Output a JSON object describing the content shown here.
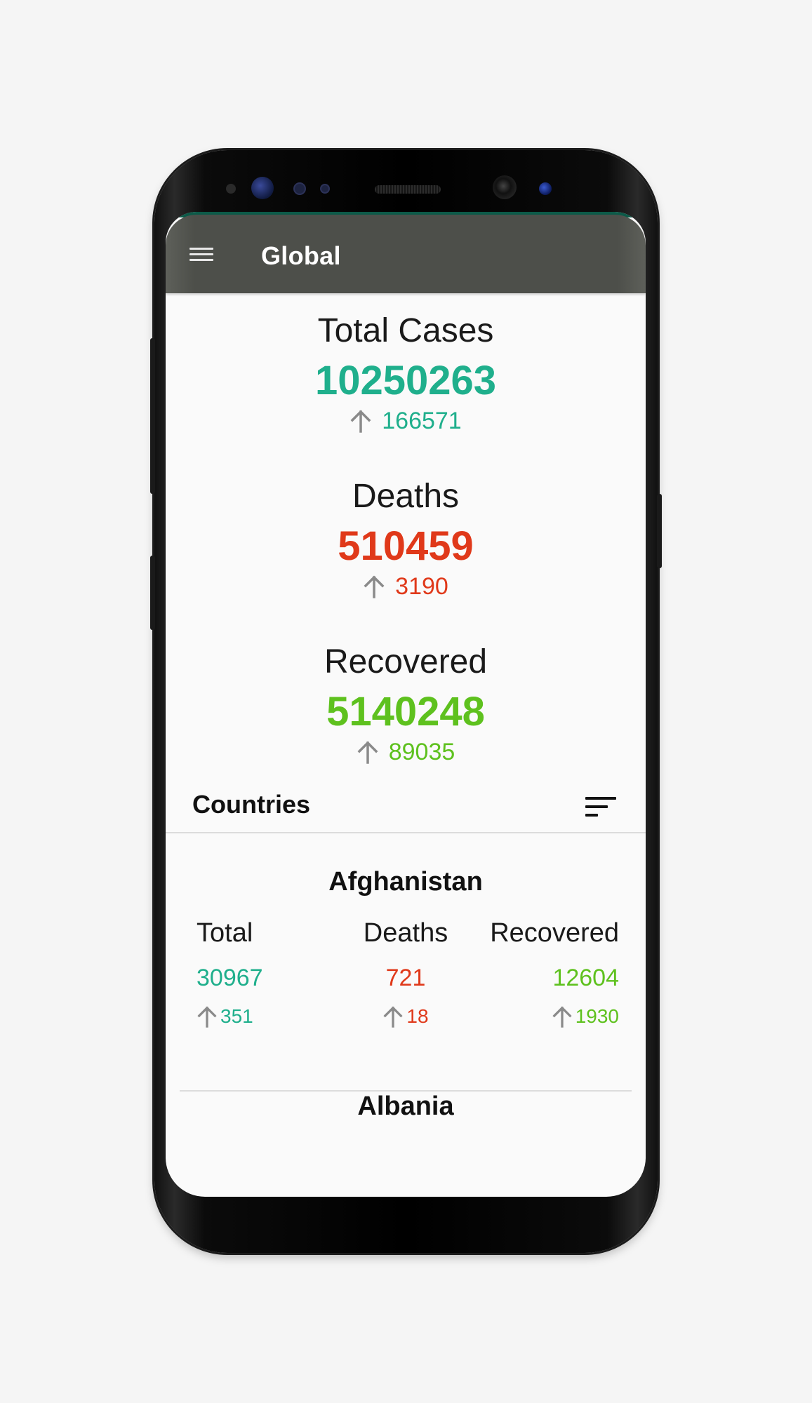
{
  "app_bar": {
    "title": "Global",
    "menu_icon": "hamburger-menu-icon"
  },
  "summary": {
    "total_cases": {
      "label": "Total Cases",
      "value": "10250263",
      "delta": "166571",
      "color": "#1faf8c"
    },
    "deaths": {
      "label": "Deaths",
      "value": "510459",
      "delta": "3190",
      "color": "#e0391a"
    },
    "recovered": {
      "label": "Recovered",
      "value": "5140248",
      "delta": "89035",
      "color": "#5ec11e"
    },
    "delta_icon": "arrow-up-icon"
  },
  "countries_section": {
    "title": "Countries",
    "sort_icon": "sort-icon"
  },
  "countries": [
    {
      "name": "Afghanistan",
      "labels": {
        "total": "Total",
        "deaths": "Deaths",
        "recovered": "Recovered"
      },
      "total": {
        "value": "30967",
        "delta": "351"
      },
      "deaths": {
        "value": "721",
        "delta": "18"
      },
      "recovered": {
        "value": "12604",
        "delta": "1930"
      }
    },
    {
      "name": "Albania"
    }
  ],
  "colors": {
    "app_bar": "#4d4f4a",
    "status_bar": "#0c5a48",
    "total": "#1faf8c",
    "deaths": "#e0391a",
    "recovered": "#5ec11e",
    "arrow": "#8a8a8a"
  }
}
